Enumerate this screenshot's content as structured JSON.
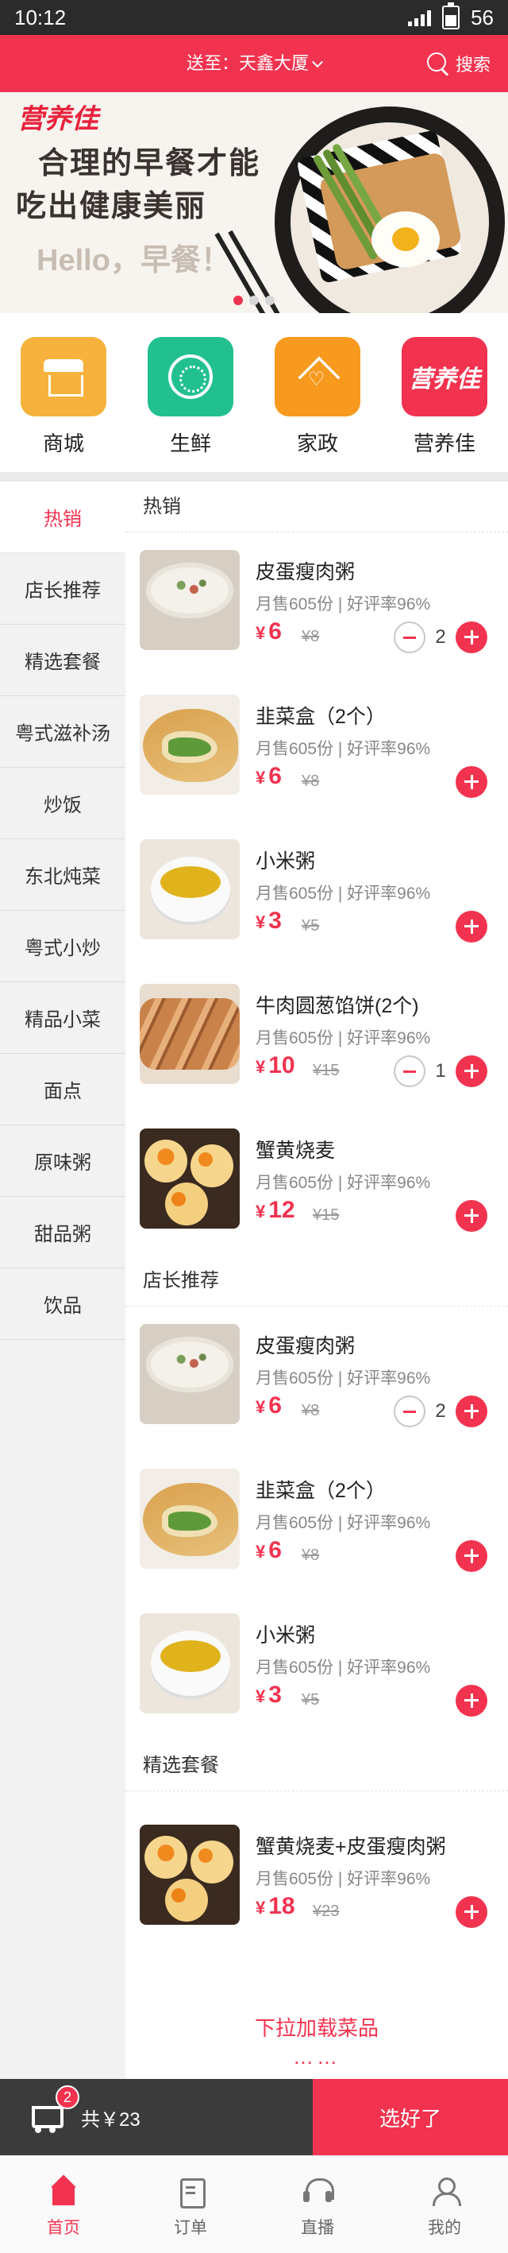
{
  "status_bar": {
    "time": "10:12",
    "battery": "56"
  },
  "header": {
    "address_label": "送至：天鑫大厦",
    "search_label": "搜索"
  },
  "banner": {
    "brand": "营养佳",
    "line1": "合理的早餐才能",
    "line2": "吃出健康美丽",
    "hello": "Hello，早餐！",
    "slides": 3,
    "active_slide": 1
  },
  "categories": [
    {
      "name": "商城",
      "icon": "store-icon",
      "color": "#f6b23c"
    },
    {
      "name": "生鲜",
      "icon": "fresh-icon",
      "color": "#22c08f"
    },
    {
      "name": "家政",
      "icon": "housekeeping-icon",
      "color": "#f79a1e"
    },
    {
      "name": "营养佳",
      "icon": "brand-logo",
      "color": "#f2334f"
    }
  ],
  "sidebar": {
    "items": [
      "热销",
      "店长推荐",
      "精选套餐",
      "粤式滋补汤",
      "炒饭",
      "东北炖菜",
      "粤式小炒",
      "精品小菜",
      "面点",
      "原味粥",
      "甜品粥",
      "饮品"
    ],
    "active": 0
  },
  "sections": [
    {
      "title": "热销",
      "items": [
        {
          "name": "皮蛋瘦肉粥",
          "sales": "月售605份",
          "rating": "好评率96%",
          "currency": "¥",
          "price": "6",
          "old_price": "¥8",
          "qty": "2",
          "image": "porridge"
        },
        {
          "name": "韭菜盒（2个）",
          "sales": "月售605份",
          "rating": "好评率96%",
          "currency": "¥",
          "price": "6",
          "old_price": "¥8",
          "qty": "",
          "image": "leek"
        },
        {
          "name": "小米粥",
          "sales": "月售605份",
          "rating": "好评率96%",
          "currency": "¥",
          "price": "3",
          "old_price": "¥5",
          "qty": "",
          "image": "millet"
        },
        {
          "name": "牛肉圆葱馅饼(2个)",
          "sales": "月售605份",
          "rating": "好评率96%",
          "currency": "¥",
          "price": "10",
          "old_price": "¥15",
          "qty": "1",
          "image": "pie"
        },
        {
          "name": "蟹黄烧麦",
          "sales": "月售605份",
          "rating": "好评率96%",
          "currency": "¥",
          "price": "12",
          "old_price": "¥15",
          "qty": "",
          "image": "shaomai"
        }
      ]
    },
    {
      "title": "店长推荐",
      "items": [
        {
          "name": "皮蛋瘦肉粥",
          "sales": "月售605份",
          "rating": "好评率96%",
          "currency": "¥",
          "price": "6",
          "old_price": "¥8",
          "qty": "2",
          "image": "porridge"
        },
        {
          "name": "韭菜盒（2个）",
          "sales": "月售605份",
          "rating": "好评率96%",
          "currency": "¥",
          "price": "6",
          "old_price": "¥8",
          "qty": "",
          "image": "leek"
        },
        {
          "name": "小米粥",
          "sales": "月售605份",
          "rating": "好评率96%",
          "currency": "¥",
          "price": "3",
          "old_price": "¥5",
          "qty": "",
          "image": "millet"
        }
      ]
    },
    {
      "title": "精选套餐",
      "items": [
        {
          "name": "蟹黄烧麦+皮蛋瘦肉粥",
          "sales": "月售605份",
          "rating": "好评率96%",
          "currency": "¥",
          "price": "18",
          "old_price": "¥23",
          "qty": "",
          "image": "shaomai"
        }
      ]
    }
  ],
  "load_more": {
    "label": "下拉加载菜品",
    "dots": "……"
  },
  "cart": {
    "count": "2",
    "total": "共￥23",
    "checkout_label": "选好了"
  },
  "tabbar": {
    "items": [
      {
        "label": "首页",
        "icon": "home-icon"
      },
      {
        "label": "订单",
        "icon": "order-icon"
      },
      {
        "label": "直播",
        "icon": "headset-icon"
      },
      {
        "label": "我的",
        "icon": "profile-icon"
      }
    ],
    "active": 0
  },
  "colors": {
    "accent": "#f2334f",
    "dark": "#3b3b3b",
    "sidebar_bg": "#f2f2f2"
  }
}
